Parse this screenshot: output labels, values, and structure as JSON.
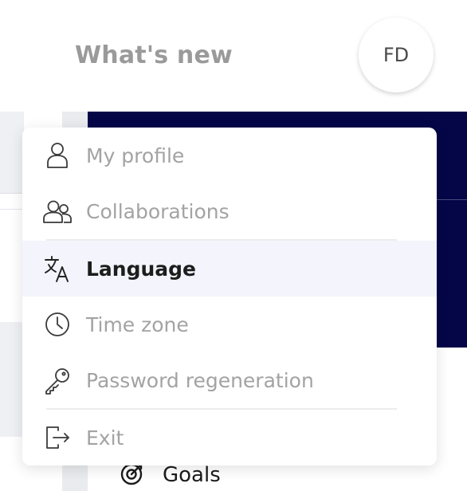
{
  "header": {
    "whats_new_label": "What's new",
    "avatar_initials": "FD"
  },
  "nav": {
    "goals_label": "Goals"
  },
  "menu": {
    "items": [
      {
        "label": "My profile",
        "icon": "person-icon",
        "active": false
      },
      {
        "label": "Collaborations",
        "icon": "users-icon",
        "active": false
      },
      {
        "label": "Language",
        "icon": "translate-icon",
        "active": true
      },
      {
        "label": "Time zone",
        "icon": "clock-icon",
        "active": false
      },
      {
        "label": "Password regeneration",
        "icon": "key-icon",
        "active": false
      },
      {
        "label": "Exit",
        "icon": "logout-icon",
        "active": false
      }
    ]
  },
  "colors": {
    "navy_background": "#040648",
    "active_item_background": "#f3f4fc",
    "inactive_text": "#a3a3a3",
    "active_text": "#1d1d1d"
  }
}
